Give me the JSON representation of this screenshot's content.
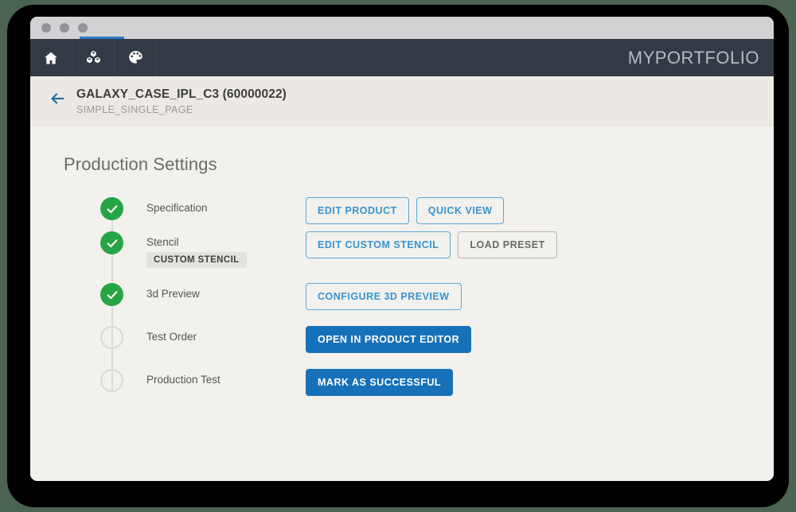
{
  "window": {
    "traffic_lights": [
      "close",
      "minimize",
      "maximize"
    ],
    "accent_tab_color": "#2b7ac4"
  },
  "navbar": {
    "brand": "MYPORTFOLIO",
    "icons": [
      {
        "name": "home-icon",
        "label": "Home"
      },
      {
        "name": "cubes-icon",
        "label": "Products"
      },
      {
        "name": "palette-icon",
        "label": "Design"
      }
    ]
  },
  "header": {
    "back_label": "Back",
    "title": "GALAXY_CASE_IPL_C3 (60000022)",
    "subtitle": "SIMPLE_SINGLE_PAGE"
  },
  "main": {
    "page_title": "Production Settings",
    "steps": [
      {
        "id": "specification",
        "label": "Specification",
        "state": "done",
        "badge": null,
        "actions": [
          {
            "label": "EDIT PRODUCT",
            "style": "outline-primary"
          },
          {
            "label": "QUICK VIEW",
            "style": "outline-primary"
          }
        ]
      },
      {
        "id": "stencil",
        "label": "Stencil",
        "state": "done",
        "badge": "CUSTOM STENCIL",
        "actions": [
          {
            "label": "EDIT CUSTOM STENCIL",
            "style": "outline-primary"
          },
          {
            "label": "LOAD PRESET",
            "style": "outline-secondary"
          }
        ]
      },
      {
        "id": "3d-preview",
        "label": "3d Preview",
        "state": "done",
        "badge": null,
        "actions": [
          {
            "label": "CONFIGURE 3D PREVIEW",
            "style": "outline-primary"
          }
        ]
      },
      {
        "id": "test-order",
        "label": "Test Order",
        "state": "pending",
        "badge": null,
        "actions": [
          {
            "label": "OPEN IN PRODUCT EDITOR",
            "style": "primary"
          }
        ]
      },
      {
        "id": "production-test",
        "label": "Production Test",
        "state": "pending",
        "badge": null,
        "actions": [
          {
            "label": "MARK AS SUCCESSFUL",
            "style": "primary"
          }
        ]
      }
    ]
  },
  "colors": {
    "navbar_bg": "#323a45",
    "header_bg": "#ece9e4",
    "content_bg": "#f2f1ed",
    "step_done": "#26a544",
    "step_pending_border": "#d8d8d2",
    "primary_button": "#1771b8",
    "outline_primary": "#3893d0",
    "back_arrow": "#1d6fa5",
    "bezel": "#000000",
    "desktop": "#4b6351"
  }
}
